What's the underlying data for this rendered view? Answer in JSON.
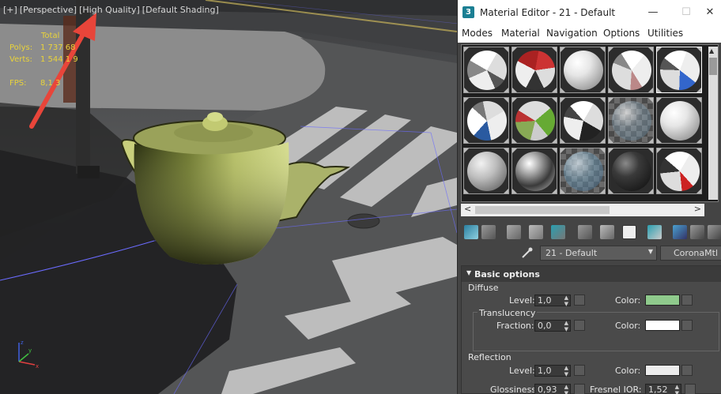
{
  "viewport": {
    "labels": [
      "[+]",
      "[Perspective]",
      "[High Quality]",
      "[Default Shading]"
    ],
    "stats": {
      "header": "Total",
      "rows": [
        {
          "label": "Polys:",
          "value": "1 737 68"
        },
        {
          "label": "Verts:",
          "value": "1 544 1 9"
        },
        {
          "label": "FPS:",
          "value": "8,1 3"
        }
      ]
    },
    "axis": {
      "x": "x",
      "y": "y",
      "z": "z"
    },
    "annotation_arrow_color": "#e8453a"
  },
  "material_editor": {
    "app_icon": "3",
    "title": "Material Editor - 21 - Default",
    "window_controls": {
      "minimize": "—",
      "maximize": "☐",
      "close": "✕"
    },
    "menu": [
      "Modes",
      "Material",
      "Navigation",
      "Options",
      "Utilities"
    ],
    "slots": [
      {
        "style": "patch-gray"
      },
      {
        "style": "patch-red"
      },
      {
        "style": "white"
      },
      {
        "style": "patch-light"
      },
      {
        "style": "patch-blue"
      },
      {
        "style": "patch-blue-white"
      },
      {
        "style": "patch-green"
      },
      {
        "style": "patch-dark"
      },
      {
        "style": "glass"
      },
      {
        "style": "white"
      },
      {
        "style": "gray"
      },
      {
        "style": "chrome"
      },
      {
        "style": "glass-blue"
      },
      {
        "style": "dark"
      },
      {
        "style": "patch-redwhite"
      }
    ],
    "material_name": "21 - Default",
    "material_type": "CoronaMtl",
    "basic_options": {
      "title": "Basic options",
      "diffuse": {
        "group": "Diffuse",
        "level_label": "Level:",
        "level_value": "1,0",
        "color_label": "Color:",
        "color": "#8fca8c"
      },
      "translucency": {
        "group": "Translucency",
        "fraction_label": "Fraction:",
        "fraction_value": "0,0",
        "color_label": "Color:",
        "color": "#ffffff"
      },
      "reflection": {
        "group": "Reflection",
        "level_label": "Level:",
        "level_value": "1,0",
        "color_label": "Color:",
        "color": "#ececec",
        "glossiness_label": "Glossiness:",
        "glossiness_value": "0,93",
        "fresnel_label": "Fresnel IOR:",
        "fresnel_value": "1,52"
      }
    }
  }
}
